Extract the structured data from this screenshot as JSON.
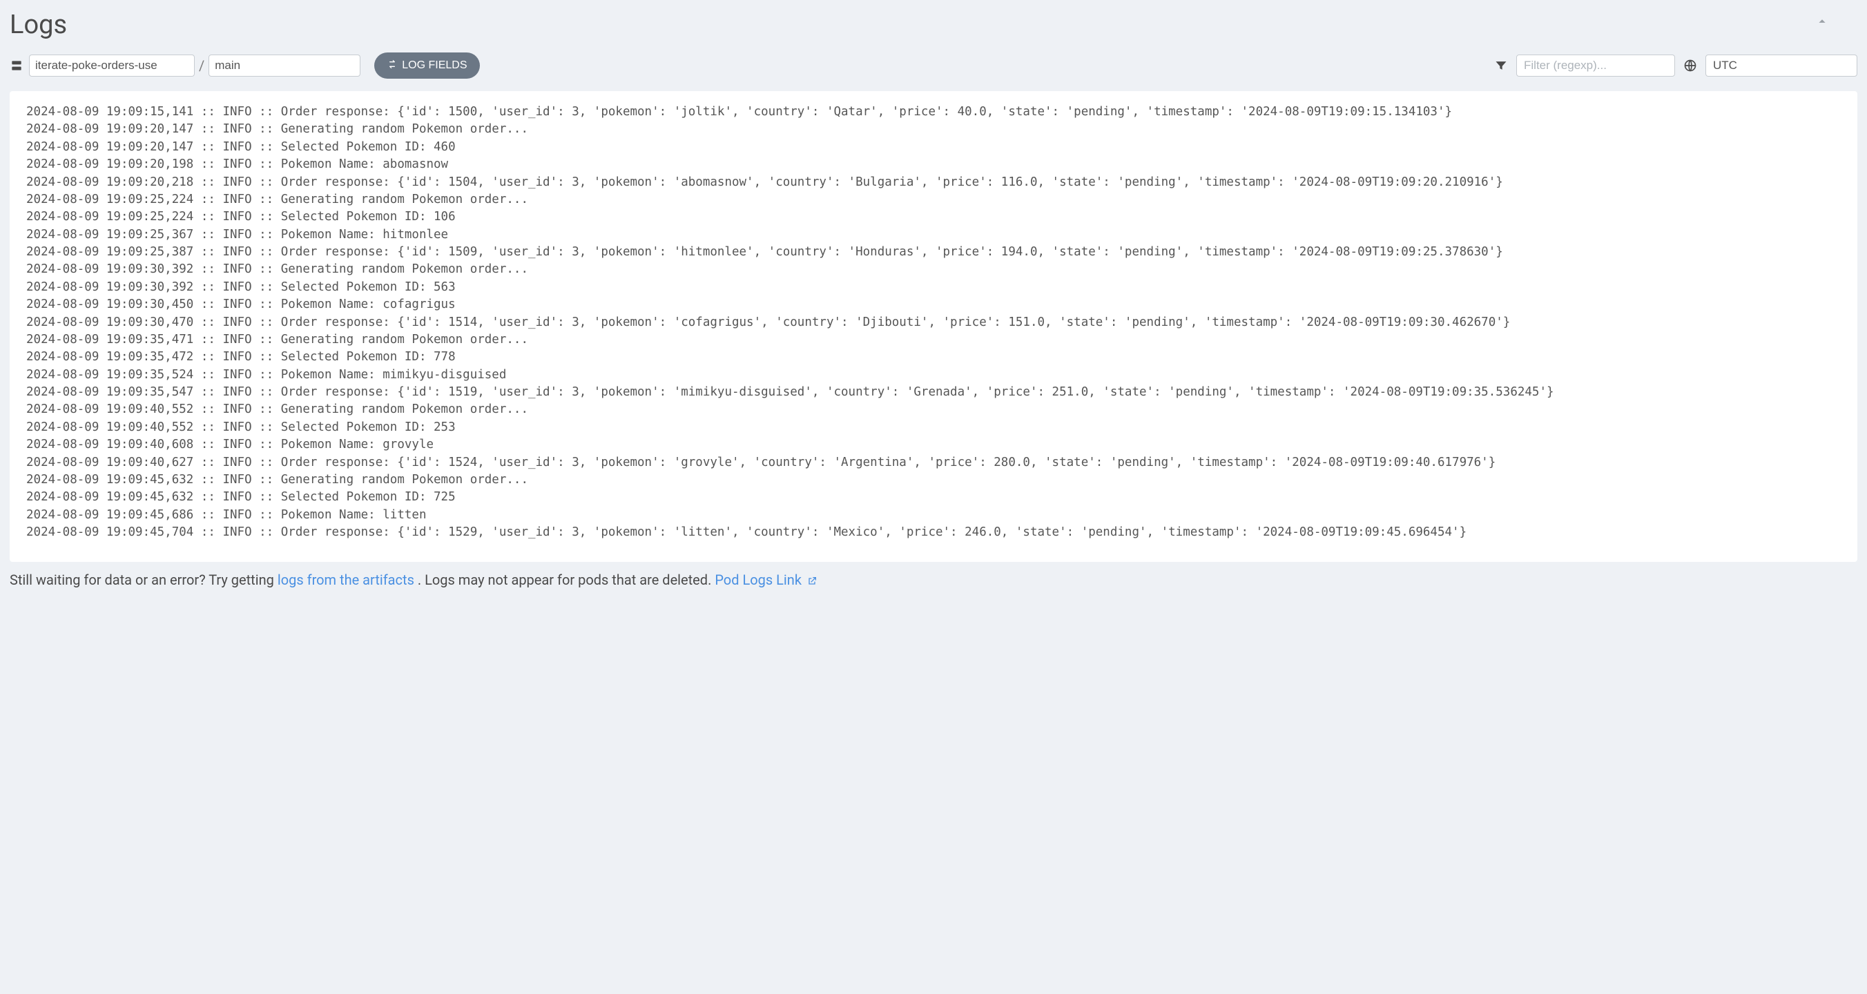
{
  "title": "Logs",
  "source": {
    "repo": "iterate-poke-orders-use",
    "branch": "main"
  },
  "log_fields_button": "LOG FIELDS",
  "filter": {
    "placeholder": "Filter (regexp)..."
  },
  "timezone": "UTC",
  "log_lines": [
    "2024-08-09 19:09:15,141 :: INFO :: Order response: {'id': 1500, 'user_id': 3, 'pokemon': 'joltik', 'country': 'Qatar', 'price': 40.0, 'state': 'pending', 'timestamp': '2024-08-09T19:09:15.134103'}",
    "2024-08-09 19:09:20,147 :: INFO :: Generating random Pokemon order...",
    "2024-08-09 19:09:20,147 :: INFO :: Selected Pokemon ID: 460",
    "2024-08-09 19:09:20,198 :: INFO :: Pokemon Name: abomasnow",
    "2024-08-09 19:09:20,218 :: INFO :: Order response: {'id': 1504, 'user_id': 3, 'pokemon': 'abomasnow', 'country': 'Bulgaria', 'price': 116.0, 'state': 'pending', 'timestamp': '2024-08-09T19:09:20.210916'}",
    "2024-08-09 19:09:25,224 :: INFO :: Generating random Pokemon order...",
    "2024-08-09 19:09:25,224 :: INFO :: Selected Pokemon ID: 106",
    "2024-08-09 19:09:25,367 :: INFO :: Pokemon Name: hitmonlee",
    "2024-08-09 19:09:25,387 :: INFO :: Order response: {'id': 1509, 'user_id': 3, 'pokemon': 'hitmonlee', 'country': 'Honduras', 'price': 194.0, 'state': 'pending', 'timestamp': '2024-08-09T19:09:25.378630'}",
    "2024-08-09 19:09:30,392 :: INFO :: Generating random Pokemon order...",
    "2024-08-09 19:09:30,392 :: INFO :: Selected Pokemon ID: 563",
    "2024-08-09 19:09:30,450 :: INFO :: Pokemon Name: cofagrigus",
    "2024-08-09 19:09:30,470 :: INFO :: Order response: {'id': 1514, 'user_id': 3, 'pokemon': 'cofagrigus', 'country': 'Djibouti', 'price': 151.0, 'state': 'pending', 'timestamp': '2024-08-09T19:09:30.462670'}",
    "2024-08-09 19:09:35,471 :: INFO :: Generating random Pokemon order...",
    "2024-08-09 19:09:35,472 :: INFO :: Selected Pokemon ID: 778",
    "2024-08-09 19:09:35,524 :: INFO :: Pokemon Name: mimikyu-disguised",
    "2024-08-09 19:09:35,547 :: INFO :: Order response: {'id': 1519, 'user_id': 3, 'pokemon': 'mimikyu-disguised', 'country': 'Grenada', 'price': 251.0, 'state': 'pending', 'timestamp': '2024-08-09T19:09:35.536245'}",
    "2024-08-09 19:09:40,552 :: INFO :: Generating random Pokemon order...",
    "2024-08-09 19:09:40,552 :: INFO :: Selected Pokemon ID: 253",
    "2024-08-09 19:09:40,608 :: INFO :: Pokemon Name: grovyle",
    "2024-08-09 19:09:40,627 :: INFO :: Order response: {'id': 1524, 'user_id': 3, 'pokemon': 'grovyle', 'country': 'Argentina', 'price': 280.0, 'state': 'pending', 'timestamp': '2024-08-09T19:09:40.617976'}",
    "2024-08-09 19:09:45,632 :: INFO :: Generating random Pokemon order...",
    "2024-08-09 19:09:45,632 :: INFO :: Selected Pokemon ID: 725",
    "2024-08-09 19:09:45,686 :: INFO :: Pokemon Name: litten",
    "2024-08-09 19:09:45,704 :: INFO :: Order response: {'id': 1529, 'user_id': 3, 'pokemon': 'litten', 'country': 'Mexico', 'price': 246.0, 'state': 'pending', 'timestamp': '2024-08-09T19:09:45.696454'}"
  ],
  "footer": {
    "text_before": "Still waiting for data or an error? Try getting ",
    "link1": "logs from the artifacts",
    "text_middle": ". Logs may not appear for pods that are deleted. ",
    "link2": "Pod Logs Link"
  }
}
